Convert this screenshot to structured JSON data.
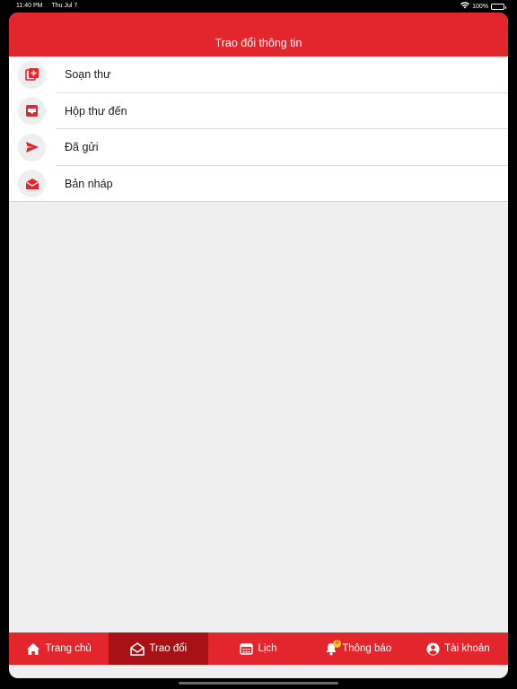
{
  "status_bar": {
    "time": "11:40 PM",
    "date": "Thu Jul 7",
    "battery_text": "100%",
    "icons": [
      "wifi-icon",
      "battery-icon"
    ]
  },
  "header": {
    "title": "Trao đổi thông tin"
  },
  "menu": {
    "items": [
      {
        "label": "Soạn thư",
        "icon": "compose-icon"
      },
      {
        "label": "Hộp thư đến",
        "icon": "inbox-icon"
      },
      {
        "label": "Đã gửi",
        "icon": "send-icon"
      },
      {
        "label": "Bản nháp",
        "icon": "draft-envelope-icon"
      }
    ]
  },
  "tab_bar": {
    "active_index": 1,
    "tabs": [
      {
        "label": "Trang chủ",
        "icon": "home-icon"
      },
      {
        "label": "Trao đổi",
        "icon": "open-envelope-icon"
      },
      {
        "label": "Lịch",
        "icon": "calendar-icon"
      },
      {
        "label": "Thông báo",
        "icon": "bell-icon",
        "badge": "0"
      },
      {
        "label": "Tài khoản",
        "icon": "user-icon"
      }
    ]
  },
  "colors": {
    "brand_red": "#e3262d",
    "active_tab": "#a81116",
    "background": "#efefef",
    "badge": "#f5c518"
  }
}
